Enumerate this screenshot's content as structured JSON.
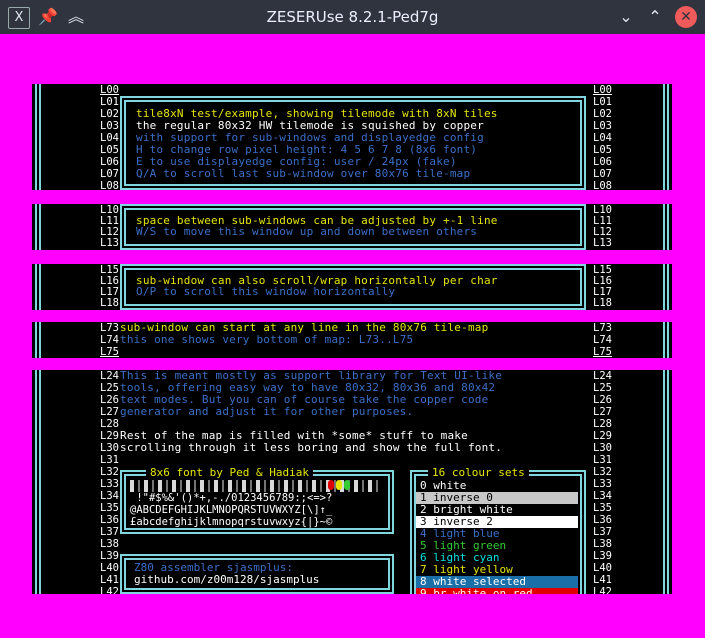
{
  "window": {
    "title": "ZESERUse 8.2.1-Ped7g",
    "app_icon": "x-app-icon",
    "pin_icon": "pin-icon",
    "shade_icon": "double-chevron-up-icon",
    "minimize_icon": "chevron-down-icon",
    "maximize_icon": "chevron-up-icon",
    "close_icon": "close-x-icon"
  },
  "colors": {
    "background": "#ff00ff",
    "frame": "#7fd6df",
    "yellow": "#e6e600",
    "blue": "#3b6ec8",
    "cyan": "#00e0e0"
  },
  "win1": {
    "labels": [
      "L00",
      "L01",
      "L02",
      "L03",
      "L04",
      "L05",
      "L06",
      "L07",
      "L08"
    ],
    "lines": [
      "tile8xN test/example, showing tilemode with 8xN tiles",
      "the regular 80x32 HW tilemode is squished by copper",
      "with support for sub-windows and displayedge config",
      "H to change row pixel height: 4 5 6 7 8 (8x6 font)",
      "E to use displayedge config: user / 24px (fake)",
      "Q/A to scroll last sub-window over 80x76 tile-map"
    ]
  },
  "win2": {
    "labels": [
      "L10",
      "L11",
      "L12",
      "L13"
    ],
    "lines": [
      "space between sub-windows can be adjusted by +-1 line",
      "W/S to move this window up and down between others"
    ]
  },
  "win3": {
    "labels": [
      "L15",
      "L16",
      "L17",
      "L18"
    ],
    "lines": [
      "sub-window can also scroll/wrap horizontally per char",
      "O/P to scroll this window horizontally"
    ]
  },
  "win4": {
    "labels": [
      "L73",
      "L74",
      "L75"
    ],
    "lines": [
      "sub-window can start at any line in the 80x76 tile-map",
      "this one shows very bottom of map: L73..L75"
    ]
  },
  "win5": {
    "labels": [
      "L24",
      "L25",
      "L26",
      "L27",
      "L28",
      "L29",
      "L30",
      "L31",
      "L32",
      "L33",
      "L34",
      "L35",
      "L36",
      "L37",
      "L38",
      "L39",
      "L40",
      "L41",
      "L42"
    ],
    "paragraph1": [
      "This is meant mostly as support library for Text UI-like",
      "tools, offering easy way to have 80x32, 80x36 and 80x42",
      "text modes. But you can of course take the copper code",
      "generator and adjust it for other purposes."
    ],
    "paragraph2": [
      "Rest of the map is filled with *some* stuff to make",
      "scrolling through it less boring and show the full font."
    ],
    "font_title": "8x6 font by Ped & Hadiak",
    "font_rows": [
      " !\"#$%&'()*+,-./0123456789:;<=>?",
      "@ABCDEFGHIJKLMNOPQRSTUVWXYZ[\\]↑_",
      "£abcdefghijklmnopqrstuvwxyz{|}~©"
    ],
    "colour_title": "16 colour sets",
    "colour_sets": [
      {
        "label": "0 white",
        "fg": "#ffffff",
        "bg": "#000000"
      },
      {
        "label": "1 inverse 0",
        "fg": "#000000",
        "bg": "#c8c8c8"
      },
      {
        "label": "2 bright white",
        "fg": "#ffffff",
        "bg": "#000000"
      },
      {
        "label": "3 inverse 2",
        "fg": "#000000",
        "bg": "#ffffff"
      },
      {
        "label": "4 light blue",
        "fg": "#3b6ec8",
        "bg": "#000000"
      },
      {
        "label": "5 light green",
        "fg": "#33cc33",
        "bg": "#000000"
      },
      {
        "label": "6 light cyan",
        "fg": "#00e0e0",
        "bg": "#000000"
      },
      {
        "label": "7 light yellow",
        "fg": "#e6e600",
        "bg": "#000000"
      },
      {
        "label": "8 white selected",
        "fg": "#ffffff",
        "bg": "#1a6fa8"
      },
      {
        "label": "9 br.white on red",
        "fg": "#ffffff",
        "bg": "#e00000"
      }
    ],
    "asm_lines": [
      "Z80 assembler sjasmplus:",
      "github.com/z00m128/sjasmplus"
    ]
  }
}
